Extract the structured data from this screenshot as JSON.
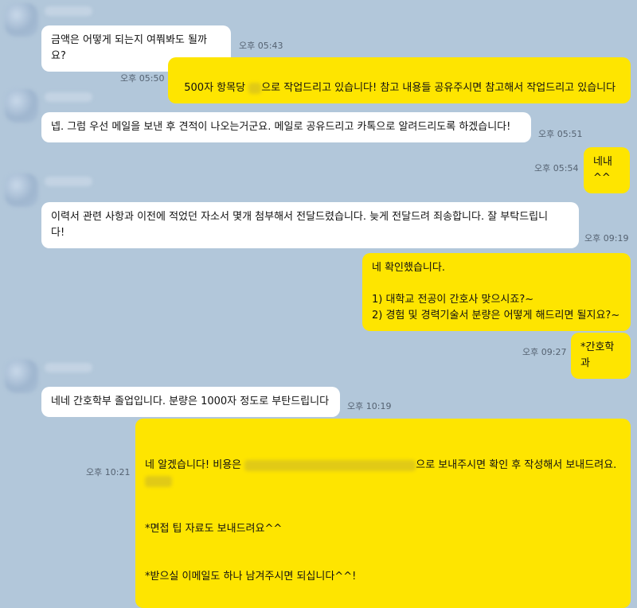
{
  "messages": [
    {
      "text": "금액은 어떻게 되는지 여쭤봐도 될까요?",
      "time": "오후 05:43"
    },
    {
      "text_before": "500자 항목당 ",
      "text_after": "으로 작업드리고 있습니다! 참고 내용들 공유주시면 참고해서 작업드리고 있습니다",
      "time": "오후 05:50"
    },
    {
      "text": "넵. 그럼 우선 메일을 보낸 후 견적이 나오는거군요. 메일로 공유드리고 카톡으로 알려드리도록 하겠습니다!",
      "time": "오후 05:51"
    },
    {
      "text": "네내^^",
      "time": "오후 05:54"
    },
    {
      "text": "이력서 관련 사항과 이전에 적었던 자소서 몇개 첨부해서 전달드렸습니다. 늦게 전달드려 죄송합니다. 잘 부탁드립니\n다!",
      "time": "오후 09:19"
    },
    {
      "text": "네 확인했습니다.\n\n1) 대학교 전공이 간호사 맞으시죠?~\n2) 경험 및 경력기술서 분량은 어떻게 해드리면 될지요?~",
      "time": ""
    },
    {
      "text": "*간호학과",
      "time": "오후 09:27"
    },
    {
      "text": "네네 간호학부 졸업입니다. 분량은 1000자 정도로 부탄드립니다",
      "time": "오후 10:19"
    },
    {
      "line1_before": "네 알겠습니다! 비용은 ",
      "line1_after": "으로 보내주시면 확인 후 작성해서 보내드려요. ",
      "line2": "*면접 팁 자료도 보내드려요^^",
      "line3": "*받으실 이메일도 하나 남겨주시면 되십니다^^!",
      "time": "오후 10:21"
    }
  ]
}
